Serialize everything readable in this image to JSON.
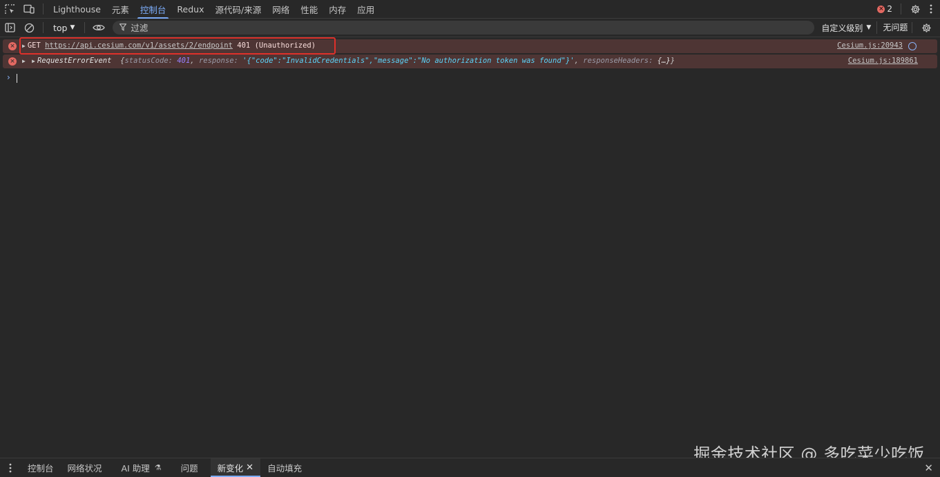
{
  "topbar": {
    "tabs": [
      {
        "label": "Lighthouse",
        "active": false
      },
      {
        "label": "元素",
        "active": false
      },
      {
        "label": "控制台",
        "active": true
      },
      {
        "label": "Redux",
        "active": false
      },
      {
        "label": "源代码/来源",
        "active": false
      },
      {
        "label": "网络",
        "active": false
      },
      {
        "label": "性能",
        "active": false
      },
      {
        "label": "内存",
        "active": false
      },
      {
        "label": "应用",
        "active": false
      }
    ],
    "error_count": "2",
    "icons": [
      "inspect-element-icon",
      "device-toolbar-icon",
      "error-icon",
      "gear-icon",
      "more-vertical-icon"
    ]
  },
  "toolbar": {
    "context": "top",
    "filter_placeholder": "过滤",
    "levels_label": "自定义级别",
    "issues_label": "无问题"
  },
  "messages": [
    {
      "method": "GET",
      "url": "https://api.cesium.com/v1/assets/2/endpoint",
      "status": "401 (Unauthorized)",
      "source": "Cesium.js:20943"
    },
    {
      "object": "RequestErrorEvent",
      "open": "{",
      "k1": "statusCode:",
      "v1": "401",
      "sep1": ",",
      "k2": "response:",
      "v2": "'{\"code\":\"InvalidCredentials\",\"message\":\"No authorization token was found\"}'",
      "sep2": ",",
      "k3": "responseHeaders:",
      "v3": "{…}",
      "close": "}",
      "source": "Cesium.js:189861"
    }
  ],
  "drawer": {
    "tabs": [
      {
        "label": "控制台",
        "active": false
      },
      {
        "label": "网络状况",
        "active": false
      },
      {
        "label": "AI 助理",
        "active": false
      },
      {
        "label": "问题",
        "active": false
      },
      {
        "label": "新变化",
        "active": true
      },
      {
        "label": "自动填充",
        "active": false
      }
    ]
  },
  "watermark": "掘金技术社区 @ 多吃菜少吃饭",
  "colors": {
    "background": "#282828",
    "accent": "#7cacf8",
    "error_bg": "#4e3534",
    "error_icon": "#e46962",
    "highlight": "#e0302a"
  }
}
